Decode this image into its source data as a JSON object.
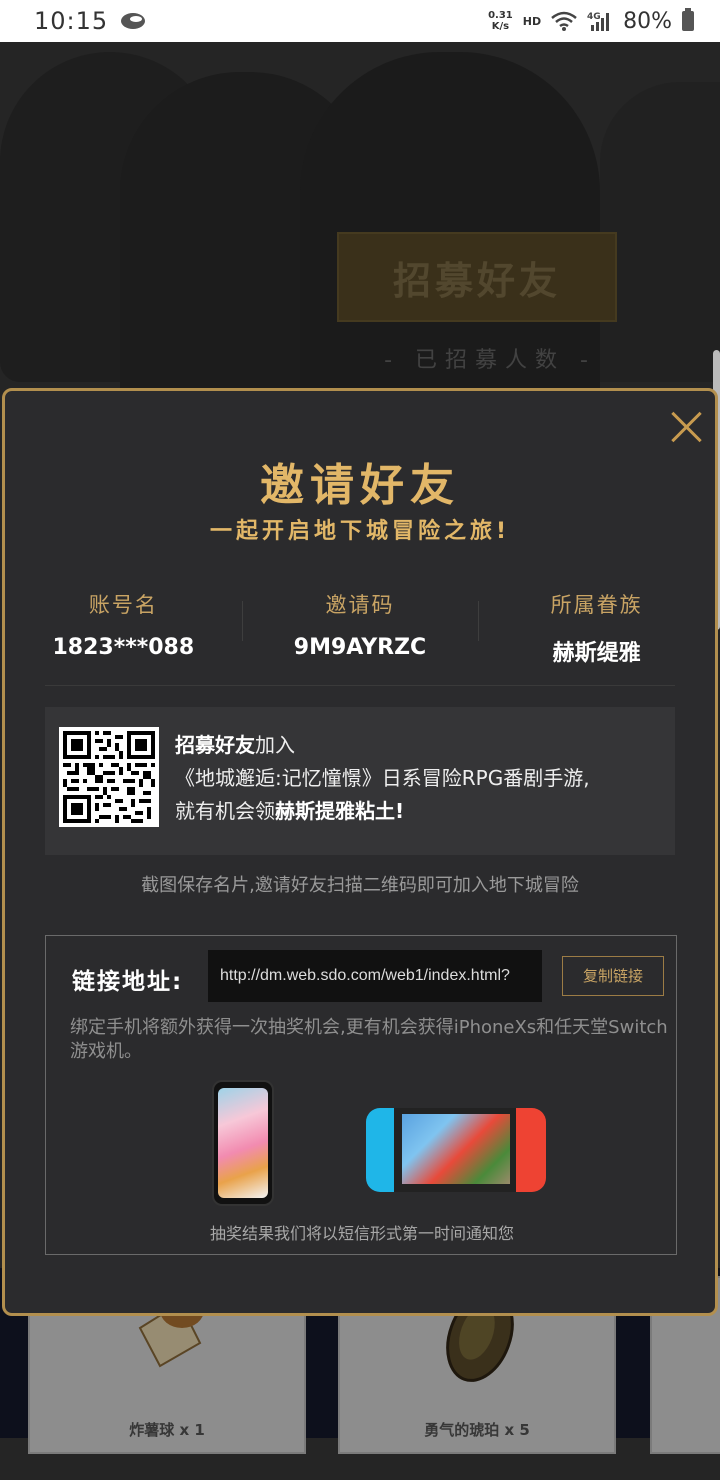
{
  "status_bar": {
    "time": "10:15",
    "net_speed_value": "0.31",
    "net_speed_unit": "K/s",
    "hd": "HD",
    "network": "4G",
    "battery": "80%"
  },
  "background": {
    "recruit_title": "招募好友",
    "recruit_count_label": "- 已招募人数 -",
    "rewards": [
      {
        "label": "炸薯球 x 1"
      },
      {
        "label": "勇气的琥珀 x 5"
      }
    ]
  },
  "modal": {
    "title": "邀请好友",
    "subtitle": "一起开启地下城冒险之旅!",
    "account_label": "账号名",
    "account_value": "1823***088",
    "invite_label": "邀请码",
    "invite_value": "9M9AYRZC",
    "faction_label": "所属眷族",
    "faction_value": "赫斯缇雅",
    "qr_line1_bold": "招募好友",
    "qr_line1_rest": "加入",
    "qr_line2": "《地城邂逅:记忆憧憬》日系冒险RPG番剧手游,",
    "qr_line3_start": "就有机会领",
    "qr_line3_bold": "赫斯提雅粘土!",
    "hint": "截图保存名片,邀请好友扫描二维码即可加入地下城冒险",
    "link_label": "链接地址:",
    "link_url": "http://dm.web.sdo.com/web1/index.html?",
    "copy_button": "复制链接",
    "bind_text": "绑定手机将额外获得一次抽奖机会,更有机会获得iPhoneXs和任天堂Switch游戏机。",
    "lottery_text": "抽奖结果我们将以短信形式第一时间通知您"
  },
  "colors": {
    "accent_gold": "#e2b768",
    "modal_border": "#b28f4e",
    "modal_bg": "#2b2b2d"
  }
}
